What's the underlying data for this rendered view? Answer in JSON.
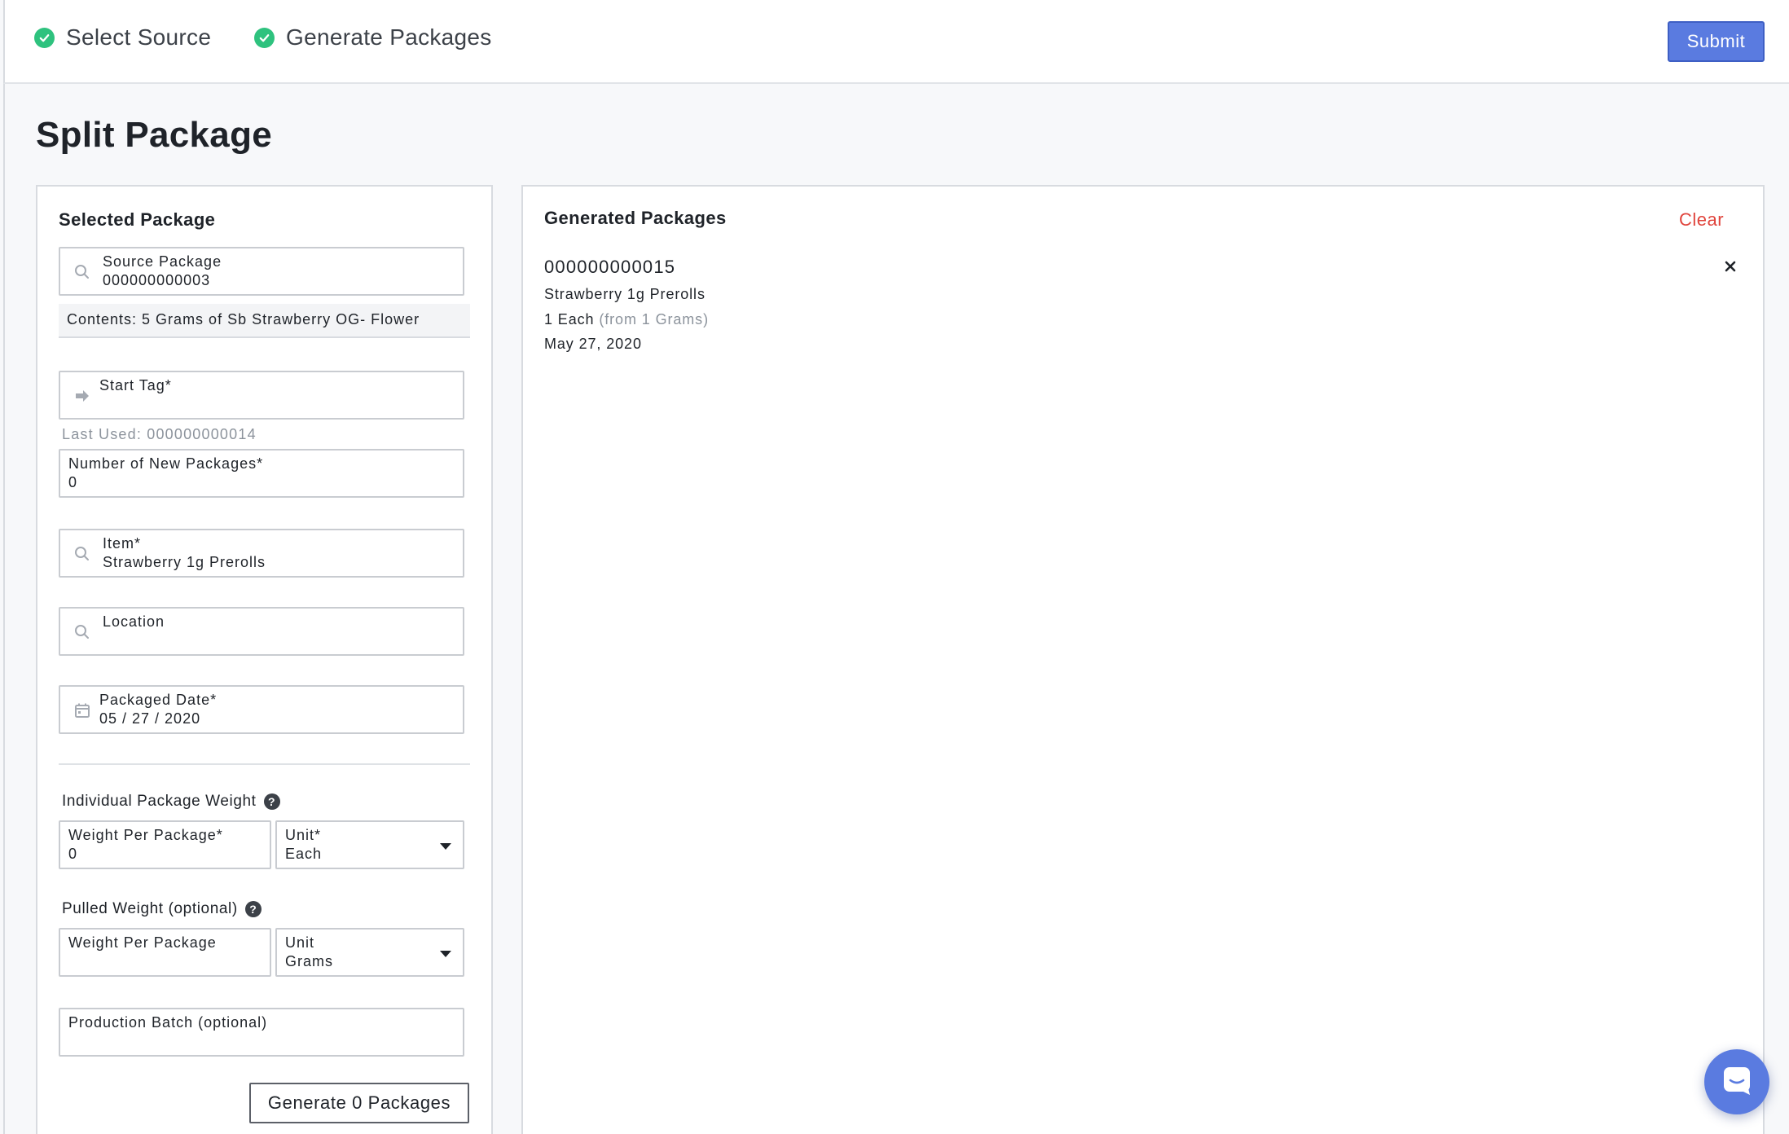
{
  "steps": [
    {
      "label": "Select Source",
      "status": "complete"
    },
    {
      "label": "Generate Packages",
      "status": "complete"
    }
  ],
  "header": {
    "submit_label": "Submit"
  },
  "page": {
    "title": "Split Package"
  },
  "selected_package": {
    "title": "Selected Package",
    "source_package": {
      "label": "Source Package",
      "value": "000000000003",
      "icon": "search-icon"
    },
    "contents": "Contents: 5 Grams of Sb Strawberry OG- Flower"
  },
  "form": {
    "start_tag": {
      "label": "Start Tag*",
      "value": "",
      "icon": "arrow-right-icon"
    },
    "last_used": "Last Used: 000000000014",
    "new_packages": {
      "label": "Number of New Packages*",
      "value": "0"
    },
    "item": {
      "label": "Item*",
      "value": "Strawberry 1g Prerolls",
      "icon": "search-icon"
    },
    "location": {
      "label": "Location",
      "value": "",
      "icon": "search-icon"
    },
    "packaged_date": {
      "label": "Packaged Date*",
      "value": "05 / 27 / 2020",
      "icon": "calendar-icon"
    },
    "individual_weight": {
      "section_label": "Individual Package Weight",
      "weight": {
        "label": "Weight Per Package*",
        "value": "0"
      },
      "unit": {
        "label": "Unit*",
        "value": "Each"
      }
    },
    "pulled_weight": {
      "section_label": "Pulled Weight (optional)",
      "weight": {
        "label": "Weight Per Package",
        "value": ""
      },
      "unit": {
        "label": "Unit",
        "value": "Grams"
      }
    },
    "production_batch": {
      "label": "Production Batch (optional)",
      "value": ""
    },
    "generate_label": "Generate 0 Packages"
  },
  "generated": {
    "title": "Generated Packages",
    "clear_label": "Clear",
    "packages": [
      {
        "tag": "000000000015",
        "item": "Strawberry 1g Prerolls",
        "quantity": "1 Each",
        "source_qty": "(from 1 Grams)",
        "date": "May 27, 2020"
      }
    ]
  },
  "colors": {
    "accent": "#5a7be0",
    "success": "#2ec27e",
    "danger": "#e0443c"
  }
}
